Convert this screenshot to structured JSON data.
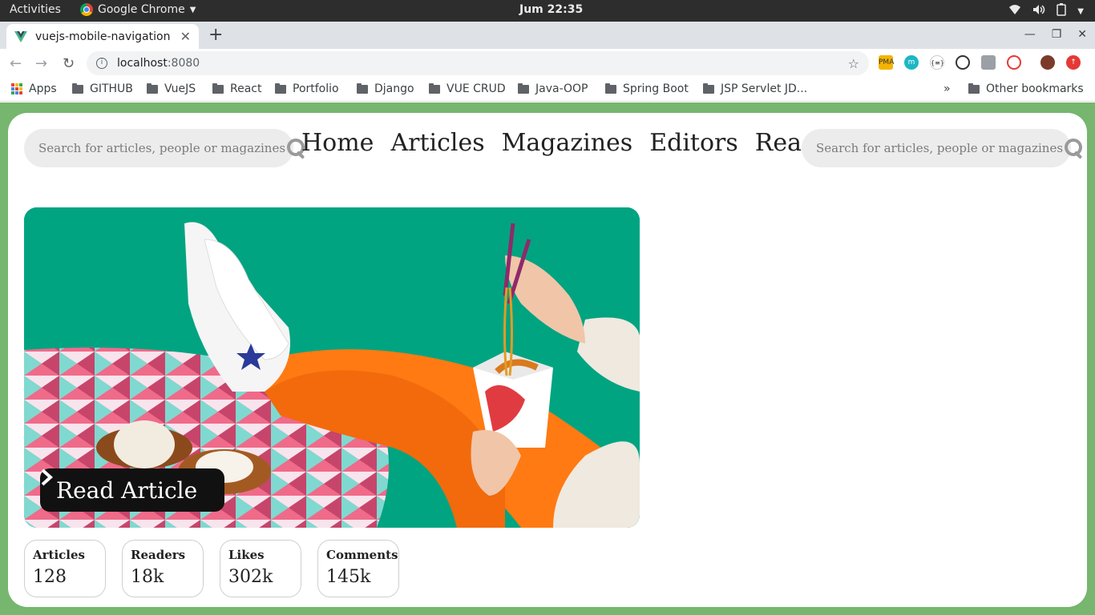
{
  "os_bar": {
    "activities": "Activities",
    "app_name": "Google Chrome",
    "clock": "Jum 22:35"
  },
  "browser": {
    "tab_title": "vuejs-mobile-navigation",
    "url_host": "localhost",
    "url_port": ":8080",
    "bookmarks": [
      "Apps",
      "GITHUB",
      "VueJS",
      "React",
      "Portfolio",
      "Django",
      "VUE CRUD",
      "Java-OOP",
      "Spring Boot",
      "JSP Servlet JD..."
    ],
    "more_bookmarks": "»",
    "other_bookmarks": "Other bookmarks"
  },
  "header": {
    "search_placeholder_left": "Search for articles, people or magazines",
    "search_placeholder_right": "Search for articles, people or magazines",
    "nav": [
      "Home",
      "Articles",
      "Magazines",
      "Editors",
      "Readers"
    ]
  },
  "hero": {
    "read_button": "Read Article",
    "colors": {
      "background": "#00a481",
      "legs": "#ff7a12",
      "button": "#111111"
    }
  },
  "stats": [
    {
      "label": "Articles",
      "value": "128"
    },
    {
      "label": "Readers",
      "value": "18k"
    },
    {
      "label": "Likes",
      "value": "302k"
    },
    {
      "label": "Comments",
      "value": "145k"
    }
  ],
  "colors": {
    "page_background": "#76b66e",
    "card": "#ffffff",
    "search_bg": "#ececec"
  },
  "icons": [
    "vue-icon",
    "search-icon",
    "chevron-right-icon",
    "folder-icon",
    "apps-icon",
    "star-icon"
  ]
}
